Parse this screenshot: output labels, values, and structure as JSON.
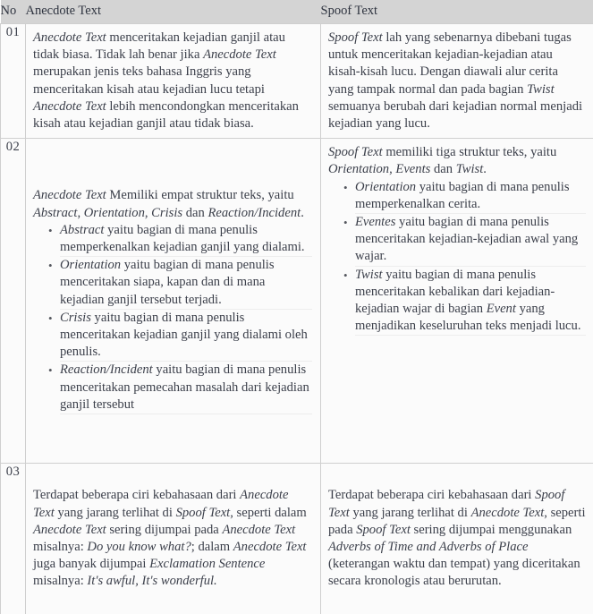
{
  "document": {
    "type": "comparison-table",
    "title": "Perbandingan Anecdote Text dan Spoof Text"
  },
  "table": {
    "headers": {
      "no": "No",
      "anecdote": "Anecdote Text",
      "spoof": "Spoof Text"
    },
    "rows": [
      {
        "no": "01",
        "anecdote": {
          "paragraph_segments": [
            {
              "text": "Anecdote Text",
              "style": "italic"
            },
            {
              "text": " menceritakan kejadian ganjil atau tidak biasa. Tidak lah benar jika ",
              "style": "normal"
            },
            {
              "text": "Anecdote Text",
              "style": "italic"
            },
            {
              "text": " merupakan jenis teks bahasa Inggris yang menceritakan kisah atau kejadian lucu tetapi ",
              "style": "normal"
            },
            {
              "text": "Anecdote Text",
              "style": "italic"
            },
            {
              "text": " lebih mencondongkan menceritakan kisah atau kejadian ganjil atau tidak biasa.",
              "style": "normal"
            }
          ],
          "plain": "Anecdote Text menceritakan kejadian ganjil atau tidak biasa. Tidak lah benar jika Anecdote Text merupakan jenis teks bahasa Inggris yang menceritakan kisah atau kejadian lucu tetapi Anecdote Text lebih mencondongkan menceritakan kisah atau kejadian ganjil atau tidak biasa."
        },
        "spoof": {
          "paragraph_segments": [
            {
              "text": "Spoof Text",
              "style": "italic"
            },
            {
              "text": " lah yang sebenarnya dibebani tugas untuk menceritakan kejadian-kejadian atau kisah-kisah lucu. Dengan diawali alur cerita yang tampak normal dan pada bagian ",
              "style": "normal"
            },
            {
              "text": "Twist",
              "style": "italic"
            },
            {
              "text": " semuanya berubah dari kejadian normal menjadi kejadian yang lucu.",
              "style": "normal"
            }
          ],
          "plain": "Spoof Text lah yang sebenarnya dibebani tugas untuk menceritakan kejadian-kejadian atau kisah-kisah lucu. Dengan diawali alur cerita yang tampak normal dan pada bagian Twist semuanya berubah dari kejadian normal menjadi kejadian yang lucu."
        }
      },
      {
        "no": "02",
        "anecdote": {
          "intro_segments": [
            {
              "text": "Anecdote Text",
              "style": "italic"
            },
            {
              "text": " Memiliki empat struktur teks, yaitu ",
              "style": "normal"
            },
            {
              "text": "Abstract",
              "style": "italic"
            },
            {
              "text": ", ",
              "style": "normal"
            },
            {
              "text": "Orientation",
              "style": "italic"
            },
            {
              "text": ", ",
              "style": "normal"
            },
            {
              "text": "Crisis",
              "style": "italic"
            },
            {
              "text": " dan ",
              "style": "normal"
            },
            {
              "text": "Reaction/Incident",
              "style": "italic"
            },
            {
              "text": ".",
              "style": "normal"
            }
          ],
          "intro_plain": "Anecdote Text Memiliki empat struktur teks, yaitu Abstract, Orientation, Crisis dan Reaction/Incident.",
          "bullets": [
            {
              "segments": [
                {
                  "text": "Abstract",
                  "style": "italic"
                },
                {
                  "text": " yaitu bagian di mana penulis memperkenalkan kejadian ganjil yang dialami.",
                  "style": "normal"
                }
              ],
              "plain": "Abstract yaitu bagian di mana penulis memperkenalkan kejadian ganjil yang dialami."
            },
            {
              "segments": [
                {
                  "text": "Orientation",
                  "style": "italic"
                },
                {
                  "text": " yaitu bagian di mana penulis menceritakan siapa, kapan dan di mana kejadian ganjil tersebut terjadi.",
                  "style": "normal"
                }
              ],
              "plain": "Orientation yaitu bagian di mana penulis menceritakan siapa, kapan dan di mana kejadian ganjil tersebut terjadi."
            },
            {
              "segments": [
                {
                  "text": "Crisis",
                  "style": "italic"
                },
                {
                  "text": " yaitu bagian di mana penulis menceritakan kejadian ganjil yang dialami oleh penulis.",
                  "style": "normal"
                }
              ],
              "plain": "Crisis yaitu bagian di mana penulis menceritakan kejadian ganjil yang dialami oleh penulis."
            },
            {
              "segments": [
                {
                  "text": "Reaction/Incident",
                  "style": "italic"
                },
                {
                  "text": " yaitu bagian di mana penulis menceritakan pemecahan masalah dari kejadian ganjil tersebut",
                  "style": "normal"
                }
              ],
              "plain": "Reaction/Incident yaitu bagian di mana penulis menceritakan pemecahan masalah dari kejadian ganjil tersebut"
            }
          ]
        },
        "spoof": {
          "intro_segments": [
            {
              "text": "Spoof Text",
              "style": "italic"
            },
            {
              "text": " memiliki tiga struktur teks, yaitu ",
              "style": "normal"
            },
            {
              "text": "Orientation",
              "style": "italic"
            },
            {
              "text": ", ",
              "style": "normal"
            },
            {
              "text": "Events",
              "style": "italic"
            },
            {
              "text": " dan ",
              "style": "normal"
            },
            {
              "text": "Twist",
              "style": "italic"
            },
            {
              "text": ".",
              "style": "normal"
            }
          ],
          "intro_plain": "Spoof Text memiliki tiga struktur teks, yaitu Orientation, Events dan Twist.",
          "bullets": [
            {
              "segments": [
                {
                  "text": "Orientation",
                  "style": "italic"
                },
                {
                  "text": " yaitu bagian di mana penulis memperkenalkan cerita.",
                  "style": "normal"
                }
              ],
              "plain": "Orientation yaitu bagian di mana penulis memperkenalkan cerita."
            },
            {
              "segments": [
                {
                  "text": "Eventes",
                  "style": "italic"
                },
                {
                  "text": " yaitu bagian di mana penulis menceritakan kejadian-kejadian awal yang wajar.",
                  "style": "normal"
                }
              ],
              "plain": "Eventes yaitu bagian di mana penulis menceritakan kejadian-kejadian awal yang wajar."
            },
            {
              "segments": [
                {
                  "text": "Twist",
                  "style": "italic"
                },
                {
                  "text": " yaitu bagian di mana penulis menceritakan kebalikan dari kejadian-kejadian wajar di bagian ",
                  "style": "normal"
                },
                {
                  "text": "Event",
                  "style": "italic"
                },
                {
                  "text": " yang menjadikan keseluruhan teks menjadi lucu.",
                  "style": "normal"
                }
              ],
              "plain": "Twist yaitu bagian di mana penulis menceritakan kebalikan dari kejadian-kejadian wajar di bagian Event yang menjadikan keseluruhan teks menjadi lucu."
            }
          ]
        }
      },
      {
        "no": "03",
        "anecdote": {
          "paragraph_segments": [
            {
              "text": "Terdapat beberapa ciri kebahasaan dari ",
              "style": "normal"
            },
            {
              "text": "Anecdote Text",
              "style": "italic"
            },
            {
              "text": " yang jarang terlihat di ",
              "style": "normal"
            },
            {
              "text": "Spoof Text",
              "style": "italic"
            },
            {
              "text": ", seperti dalam ",
              "style": "normal"
            },
            {
              "text": "Anecdote Text",
              "style": "italic"
            },
            {
              "text": " sering dijumpai pada ",
              "style": "normal"
            },
            {
              "text": "Anecdote Text",
              "style": "italic"
            },
            {
              "text": " misalnya: ",
              "style": "normal"
            },
            {
              "text": "Do you know what?",
              "style": "italic"
            },
            {
              "text": "; dalam ",
              "style": "normal"
            },
            {
              "text": "Anecdote Text",
              "style": "italic"
            },
            {
              "text": " juga banyak dijumpai ",
              "style": "normal"
            },
            {
              "text": "Exclamation Sentence",
              "style": "italic"
            },
            {
              "text": " misalnya: ",
              "style": "normal"
            },
            {
              "text": "It's awful, It's wonderful.",
              "style": "italic"
            }
          ],
          "plain": "Terdapat beberapa ciri kebahasaan dari Anecdote Text yang jarang terlihat di Spoof Text, seperti dalam Anecdote Text sering dijumpai pada Anecdote Text misalnya: Do you know what?; dalam Anecdote Text juga banyak dijumpai Exclamation Sentence misalnya: It's awful, It's wonderful."
        },
        "spoof": {
          "paragraph_segments": [
            {
              "text": "Terdapat beberapa ciri kebahasaan dari ",
              "style": "normal"
            },
            {
              "text": "Spoof Text",
              "style": "italic"
            },
            {
              "text": " yang jarang terlihat di ",
              "style": "normal"
            },
            {
              "text": "Anecdote Text",
              "style": "italic"
            },
            {
              "text": ", seperti pada ",
              "style": "normal"
            },
            {
              "text": "Spoof Text",
              "style": "italic"
            },
            {
              "text": " sering dijumpai menggunakan ",
              "style": "normal"
            },
            {
              "text": "Adverbs of Time and Adverbs of Place",
              "style": "italic"
            },
            {
              "text": " (keterangan waktu dan tempat) yang diceritakan secara kronologis atau berurutan.",
              "style": "normal"
            }
          ],
          "plain": "Terdapat beberapa ciri kebahasaan dari Spoof Text yang jarang terlihat di Anecdote Text, seperti pada Spoof Text sering dijumpai menggunakan Adverbs of Time and Adverbs of Place (keterangan waktu dan tempat) yang diceritakan secara kronologis atau berurutan."
        }
      }
    ]
  },
  "colors": {
    "header_background": "#d4d4d4",
    "cell_background": "#fbfbfb",
    "text": "#3b3f4a",
    "border": "#cfcfcf",
    "bullet_separator": "#ededed"
  }
}
